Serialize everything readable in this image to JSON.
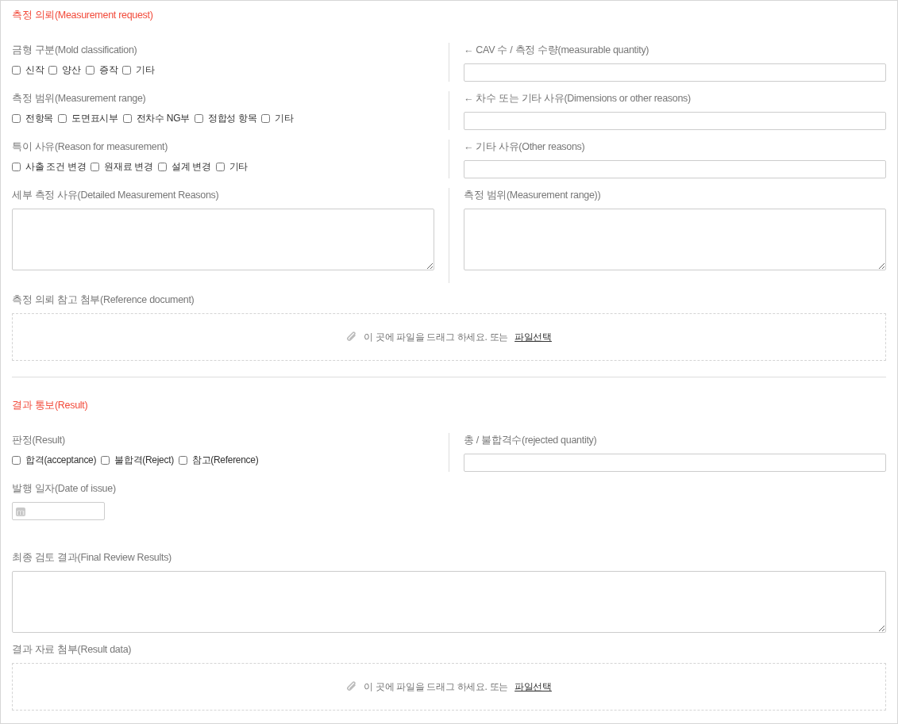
{
  "sections": [
    {
      "title": "측정 의뢰(Measurement request)",
      "rows": [
        {
          "fields": [
            {
              "kind": "checks",
              "label": "금형 구분(Mold classification)",
              "options": [
                {
                  "label": "신작",
                  "checked": false
                },
                {
                  "label": "양산",
                  "checked": false
                },
                {
                  "label": "증작",
                  "checked": false
                },
                {
                  "label": "기타",
                  "checked": false
                }
              ]
            },
            {
              "kind": "input",
              "label": "← CAV 수 / 측정 수량(measurable quantity)"
            }
          ]
        },
        {
          "fields": [
            {
              "kind": "checks",
              "label": "측정 범위(Measurement range)",
              "options": [
                {
                  "label": "전항목",
                  "checked": false
                },
                {
                  "label": "도면표시부",
                  "checked": false
                },
                {
                  "label": "전차수 NG부",
                  "checked": false
                },
                {
                  "label": "정합성 항목",
                  "checked": false
                },
                {
                  "label": "기타",
                  "checked": false
                }
              ]
            },
            {
              "kind": "input",
              "label": "← 차수 또는 기타 사유(Dimensions or other reasons)"
            }
          ]
        },
        {
          "fields": [
            {
              "kind": "checks",
              "label": "특이 사유(Reason for measurement)",
              "options": [
                {
                  "label": "사출 조건 변경",
                  "checked": false
                },
                {
                  "label": "원재료 변경",
                  "checked": false
                },
                {
                  "label": "설계 변경",
                  "checked": false
                },
                {
                  "label": "기타",
                  "checked": false
                }
              ]
            },
            {
              "kind": "input",
              "label": "← 기타 사유(Other reasons)"
            }
          ]
        },
        {
          "fields": [
            {
              "kind": "textarea",
              "label": "세부 측정 사유(Detailed Measurement Reasons)"
            },
            {
              "kind": "textarea",
              "label": "측정 범위(Measurement range))"
            }
          ]
        },
        {
          "fields": [
            {
              "kind": "upload",
              "label": "측정 의뢰 참고 첨부(Reference document)",
              "hint": "이 곳에 파일을 드래그 하세요. 또는",
              "link": "파일선택"
            }
          ]
        }
      ]
    },
    {
      "title": "결과 통보(Result)",
      "rows": [
        {
          "fields": [
            {
              "kind": "checks",
              "label": "판정(Result)",
              "options": [
                {
                  "label": "합격(acceptance)",
                  "checked": false
                },
                {
                  "label": "불합격(Reject)",
                  "checked": false
                },
                {
                  "label": "참고(Reference)",
                  "checked": false
                }
              ]
            },
            {
              "kind": "input",
              "label": "총 / 불합격수(rejected quantity)"
            }
          ]
        },
        {
          "fields": [
            {
              "kind": "date",
              "label": "발행 일자(Date of issue)"
            }
          ]
        },
        {
          "fields": [
            {
              "kind": "textarea",
              "label": "최종 검토 결과(Final Review Results)"
            }
          ]
        },
        {
          "fields": [
            {
              "kind": "upload",
              "label": "결과 자료 첨부(Result data)",
              "hint": "이 곳에 파일을 드래그 하세요. 또는",
              "link": "파일선택"
            }
          ]
        }
      ]
    }
  ]
}
